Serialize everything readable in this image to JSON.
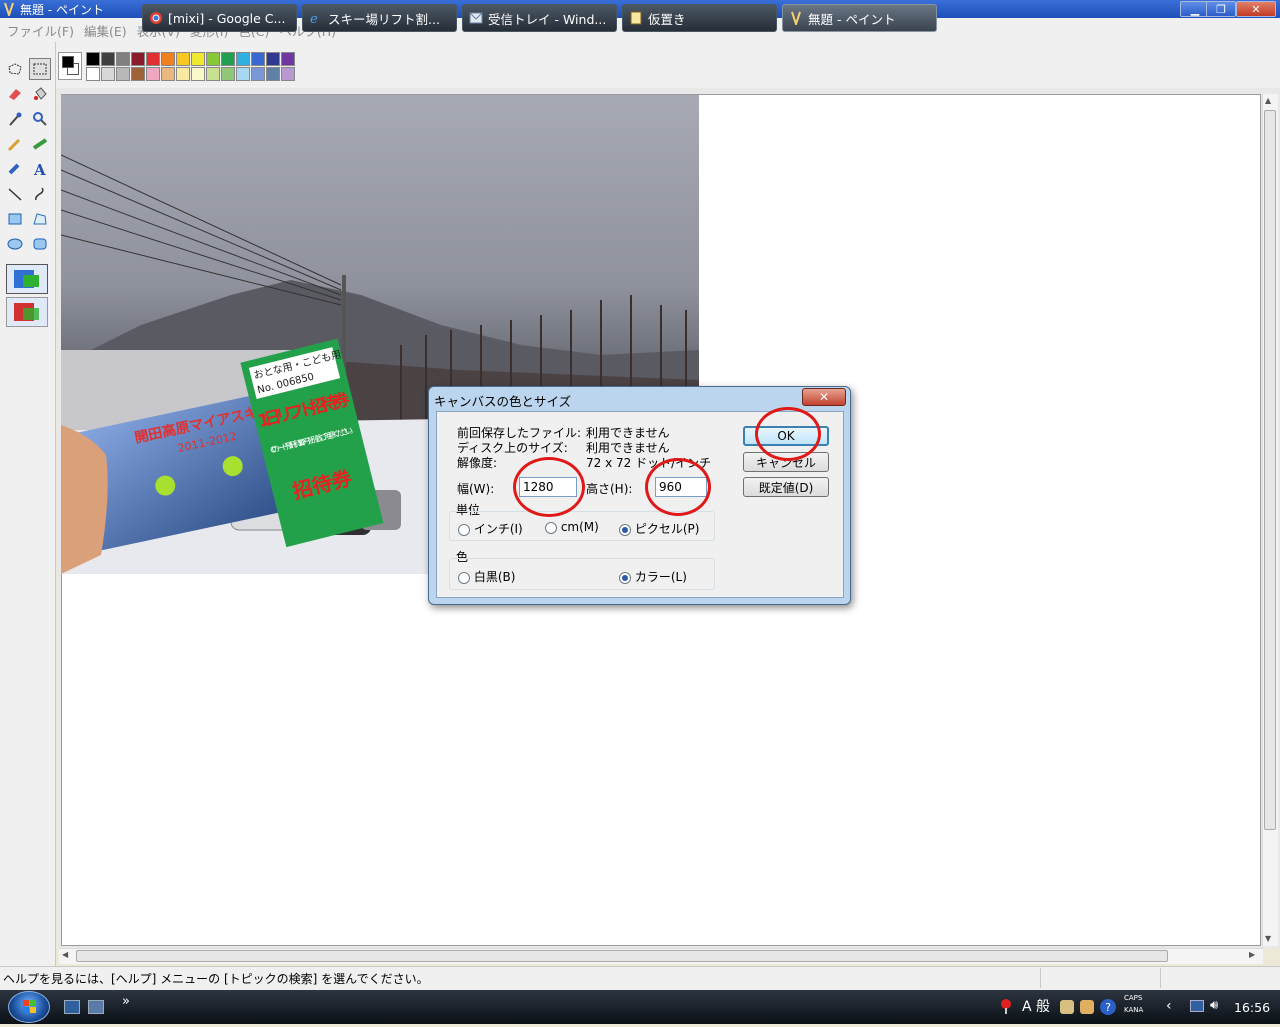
{
  "window": {
    "title": "無題 - ペイント",
    "minimize": "▁",
    "restore": "❐",
    "close": "✕"
  },
  "menu": [
    "ファイル(F)",
    "編集(E)",
    "表示(V)",
    "変形(I)",
    "色(C)",
    "ヘルプ(H)"
  ],
  "palette": {
    "top": [
      "#000000",
      "#404040",
      "#808080",
      "#8b1a2a",
      "#e03030",
      "#f08020",
      "#f8c820",
      "#f0e830",
      "#88c838",
      "#20a050",
      "#30b0e0",
      "#3868d0",
      "#303890",
      "#7038a0"
    ],
    "bottom": [
      "#ffffff",
      "#d8d8d8",
      "#b8b8b8",
      "#a06038",
      "#f0a8c0",
      "#e8b880",
      "#f8e8a0",
      "#f8f8c8",
      "#c8e090",
      "#90c878",
      "#a8d8f0",
      "#7898d8",
      "#6080a8",
      "#b898d0"
    ],
    "foreground": "#000000",
    "background": "#ffffff"
  },
  "statusbar": {
    "help": "ヘルプを見るには、[ヘルプ] メニューの [トピックの検索] を選んでください。"
  },
  "dialog": {
    "title": "キャンバスの色とサイズ",
    "close": "✕",
    "last_saved_label": "前回保存したファイル:",
    "last_saved_value": "利用できません",
    "disk_size_label": "ディスク上のサイズ:",
    "disk_size_value": "利用できません",
    "resolution_label": "解像度:",
    "resolution_value": "72 x 72 ドット/インチ",
    "width_label": "幅(W):",
    "width_value": "1280",
    "height_label": "高さ(H):",
    "height_value": "960",
    "units_label": "単位",
    "unit_inch": "インチ(I)",
    "unit_cm": "cm(M)",
    "unit_pixel": "ピクセル(P)",
    "color_label": "色",
    "color_bw": "白黒(B)",
    "color_color": "カラー(L)",
    "ok": "OK",
    "cancel": "キャンセル",
    "default": "既定値(D)"
  },
  "taskbar": {
    "chevron": "»",
    "tasks": [
      "[mixi] - Google C...",
      "スキー場リフト割...",
      "受信トレイ - Wind...",
      "仮置き",
      "無題 - ペイント"
    ],
    "ime": "A 般",
    "caps": "CAPS",
    "kana": "KANA",
    "clock": "16:56"
  },
  "photo": {
    "ticket_title": "開田高原マイアスキー場",
    "ticket_year": "2011-2012",
    "coupon_header": "おとな用・こども用",
    "coupon_number": "No. 006850",
    "coupon_main": "1日リフト招待券",
    "coupon_main2": "招待券",
    "coupon_note": "ICカード預託料500円を別途ご用意ください。"
  }
}
